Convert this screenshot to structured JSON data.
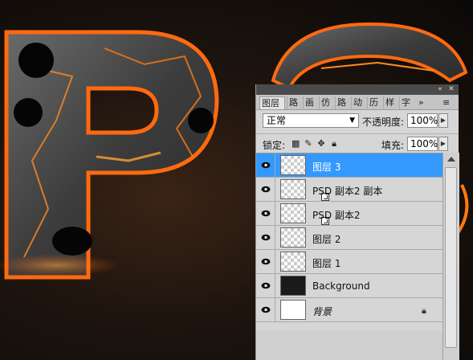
{
  "panel": {
    "tabs": [
      {
        "label": "图层",
        "active": true
      },
      {
        "label": "路"
      },
      {
        "label": "画"
      },
      {
        "label": "仿"
      },
      {
        "label": "路"
      },
      {
        "label": "动"
      },
      {
        "label": "历"
      },
      {
        "label": "样"
      },
      {
        "label": "字"
      }
    ],
    "blend_mode": "正常",
    "opacity_label": "不透明度:",
    "opacity_value": "100%",
    "lock_label": "锁定:",
    "fill_label": "填充:",
    "fill_value": "100%",
    "layers": [
      {
        "name": "图层 3",
        "selected": true,
        "visible": true,
        "thumb": "checker"
      },
      {
        "name": "PSD 副本2 副本",
        "selected": false,
        "visible": true,
        "thumb": "checker",
        "smart": true
      },
      {
        "name": "PSD 副本2",
        "selected": false,
        "visible": true,
        "thumb": "checker",
        "smart": true
      },
      {
        "name": "图层 2",
        "selected": false,
        "visible": true,
        "thumb": "checker"
      },
      {
        "name": "图层 1",
        "selected": false,
        "visible": true,
        "thumb": "checker"
      },
      {
        "name": "Background",
        "selected": false,
        "visible": true,
        "thumb": "dark"
      },
      {
        "name": "背景",
        "selected": false,
        "visible": true,
        "thumb": "white",
        "locked": true
      }
    ]
  },
  "colors": {
    "selection": "#3399ff",
    "panel_bg": "#d6d6d6",
    "lava": "#ff7a1a"
  }
}
